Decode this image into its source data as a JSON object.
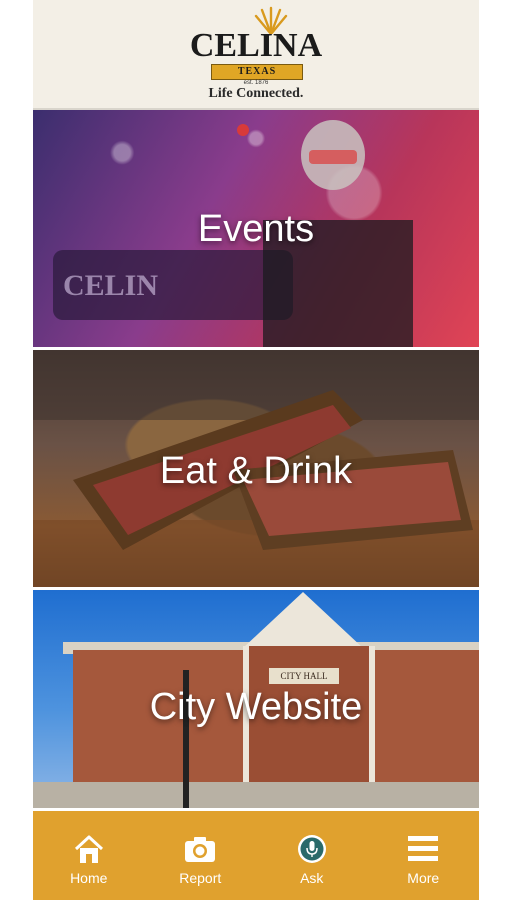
{
  "header": {
    "logo_word": "CELINA",
    "logo_state": "TEXAS",
    "logo_est": "est. 1876",
    "tagline": "Life Connected."
  },
  "tiles": [
    {
      "label": "Events"
    },
    {
      "label": "Eat & Drink"
    },
    {
      "label": "City Website"
    }
  ],
  "city_photo": {
    "plaque": "CITY HALL"
  },
  "nav": [
    {
      "label": "Home",
      "icon": "home-icon"
    },
    {
      "label": "Report",
      "icon": "camera-icon"
    },
    {
      "label": "Ask",
      "icon": "microphone-icon"
    },
    {
      "label": "More",
      "icon": "hamburger-menu-icon"
    }
  ],
  "colors": {
    "header_bg": "#f3efe6",
    "nav_bg": "#e0a12e",
    "logo_gold": "#e0a625",
    "ask_icon_bg": "#2a6a6a"
  }
}
